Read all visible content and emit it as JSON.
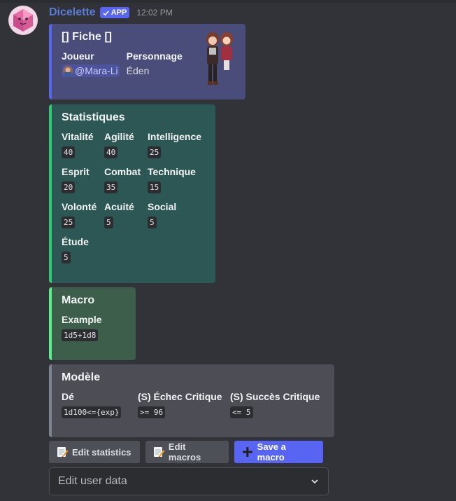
{
  "message": {
    "username": "Dicelette",
    "badge": "APP",
    "timestamp": "12:02 PM"
  },
  "fiche": {
    "title": "[] Fiche []",
    "player_label": "Joueur",
    "player_value": "@Mara-Li",
    "character_label": "Personnage",
    "character_value": "Éden",
    "color": "#5865f2"
  },
  "stats": {
    "title": "Statistiques",
    "color": "#2ecc71",
    "fields": [
      {
        "name": "Vitalité",
        "value": "40"
      },
      {
        "name": "Agilité",
        "value": "40"
      },
      {
        "name": "Intelligence",
        "value": "25"
      },
      {
        "name": "Esprit",
        "value": "20"
      },
      {
        "name": "Combat",
        "value": "35"
      },
      {
        "name": "Technique",
        "value": "15"
      },
      {
        "name": "Volonté",
        "value": "25"
      },
      {
        "name": "Acuité",
        "value": "5"
      },
      {
        "name": "Social",
        "value": "5"
      },
      {
        "name": "Étude",
        "value": "5"
      }
    ]
  },
  "macro": {
    "title": "Macro",
    "color": "#57f287",
    "field_name": "Example",
    "field_value": "1d5+1d8"
  },
  "model": {
    "title": "Modèle",
    "color": "#80848e",
    "fields": [
      {
        "name": "Dé",
        "value": "1d100<={exp}"
      },
      {
        "name": "(S) Échec Critique",
        "value": ">= 96"
      },
      {
        "name": "(S) Succès Critique",
        "value": "<= 5"
      }
    ]
  },
  "buttons": {
    "edit_stats": "Edit statistics",
    "edit_macros": "Edit macros",
    "save_macro": "Save a macro"
  },
  "select": {
    "placeholder": "Edit user data"
  }
}
